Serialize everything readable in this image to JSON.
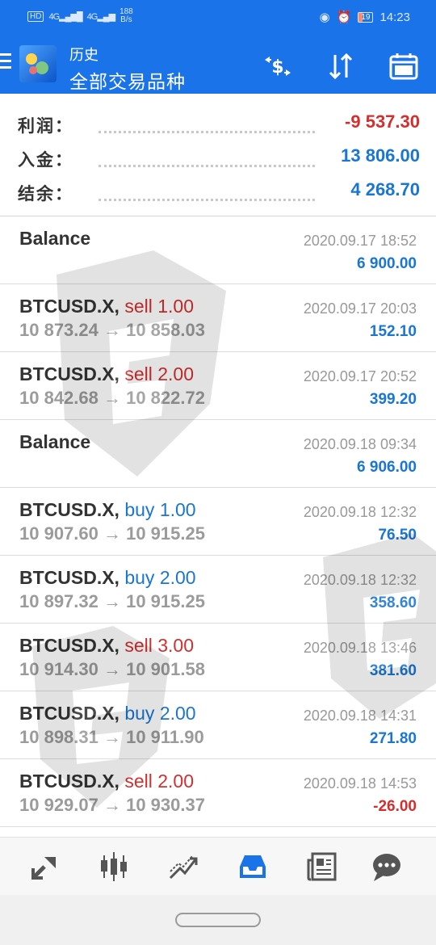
{
  "status_bar": {
    "left_indicators": [
      "HD",
      "4G",
      "4G"
    ],
    "speed_value": "188",
    "speed_unit": "B/s",
    "battery": "19",
    "time": "14:23"
  },
  "header": {
    "section": "历史",
    "filter": "全部交易品种",
    "icons": [
      "menu-icon",
      "app-logo-icon",
      "currency-swap-icon",
      "sort-icon",
      "calendar-icon"
    ]
  },
  "summary": [
    {
      "label": "利润：",
      "value": "-9 537.30",
      "color": "#d32f2f"
    },
    {
      "label": "入金：",
      "value": "13 806.00",
      "color": "#1976d2"
    },
    {
      "label": "结余：",
      "value": "4 268.70",
      "color": "#1976d2"
    }
  ],
  "history": [
    {
      "symbol": "Balance",
      "action": "",
      "prices": "",
      "time": "2020.09.17 18:52",
      "profit": "6 900.00",
      "profit_color": "#1976d2"
    },
    {
      "symbol": "BTCUSD.X,",
      "action": "sell 1.00",
      "action_color": "#d32f2f",
      "prices": "10 873.24 → 10 858.03",
      "time": "2020.09.17 20:03",
      "profit": "152.10",
      "profit_color": "#1976d2"
    },
    {
      "symbol": "BTCUSD.X,",
      "action": "sell 2.00",
      "action_color": "#d32f2f",
      "prices": "10 842.68 → 10 822.72",
      "time": "2020.09.17 20:52",
      "profit": "399.20",
      "profit_color": "#1976d2"
    },
    {
      "symbol": "Balance",
      "action": "",
      "prices": "",
      "time": "2020.09.18 09:34",
      "profit": "6 906.00",
      "profit_color": "#1976d2"
    },
    {
      "symbol": "BTCUSD.X,",
      "action": "buy 1.00",
      "action_color": "#1976d2",
      "prices": "10 907.60 → 10 915.25",
      "time": "2020.09.18 12:32",
      "profit": "76.50",
      "profit_color": "#1976d2"
    },
    {
      "symbol": "BTCUSD.X,",
      "action": "buy 2.00",
      "action_color": "#1976d2",
      "prices": "10 897.32 → 10 915.25",
      "time": "2020.09.18 12:32",
      "profit": "358.60",
      "profit_color": "#1976d2"
    },
    {
      "symbol": "BTCUSD.X,",
      "action": "sell 3.00",
      "action_color": "#d32f2f",
      "prices": "10 914.30 → 10 901.58",
      "time": "2020.09.18 13:46",
      "profit": "381.60",
      "profit_color": "#1976d2"
    },
    {
      "symbol": "BTCUSD.X,",
      "action": "buy 2.00",
      "action_color": "#1976d2",
      "prices": "10 898.31 → 10 911.90",
      "time": "2020.09.18 14:31",
      "profit": "271.80",
      "profit_color": "#1976d2"
    },
    {
      "symbol": "BTCUSD.X,",
      "action": "sell 2.00",
      "action_color": "#d32f2f",
      "prices": "10 929.07 → 10 930.37",
      "time": "2020.09.18 14:53",
      "profit": "-26.00",
      "profit_color": "#d32f2f"
    }
  ],
  "bottom_nav": [
    {
      "name": "quotes",
      "icon": "quotes-arrows-icon",
      "active": false
    },
    {
      "name": "chart",
      "icon": "candlestick-icon",
      "active": false
    },
    {
      "name": "trade",
      "icon": "trend-lines-icon",
      "active": false
    },
    {
      "name": "history",
      "icon": "inbox-icon",
      "active": true
    },
    {
      "name": "news",
      "icon": "newspaper-icon",
      "active": false
    },
    {
      "name": "messages",
      "icon": "chat-bubble-icon",
      "active": false
    }
  ],
  "colors": {
    "accent": "#1a73e8",
    "profit": "#1976d2",
    "loss": "#d32f2f",
    "nav_icon": "#555555",
    "nav_active": "#1a73e8"
  }
}
